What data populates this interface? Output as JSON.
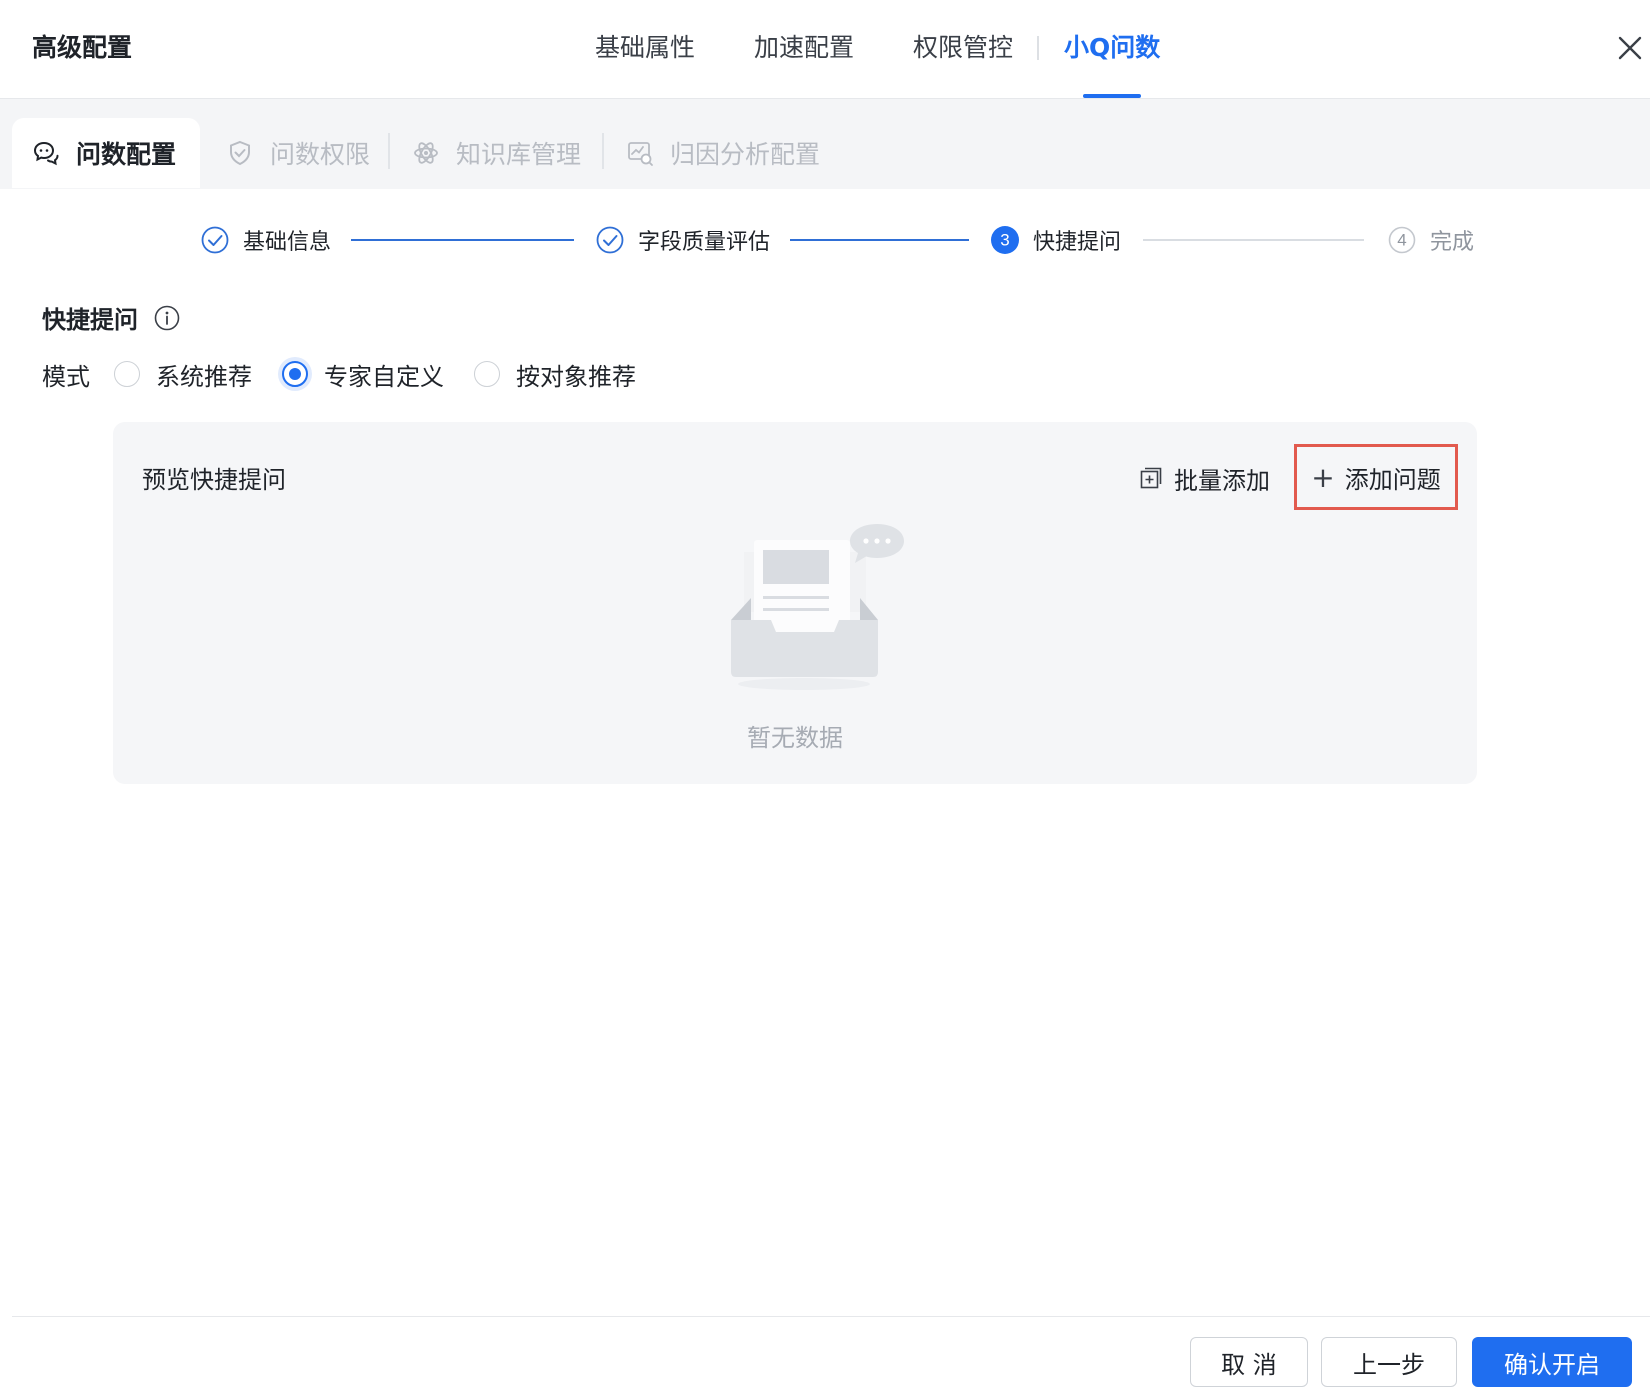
{
  "dialog": {
    "title": "高级配置"
  },
  "top_tabs": [
    {
      "label": "基础属性",
      "active": false
    },
    {
      "label": "加速配置",
      "active": false
    },
    {
      "label": "权限管控",
      "active": false
    },
    {
      "label": "小Q问数",
      "active": true
    }
  ],
  "sub_tabs": [
    {
      "label": "问数配置",
      "icon": "chat-bubbles-icon",
      "active": true
    },
    {
      "label": "问数权限",
      "icon": "shield-check-icon",
      "active": false
    },
    {
      "label": "知识库管理",
      "icon": "atom-icon",
      "active": false
    },
    {
      "label": "归因分析配置",
      "icon": "chart-analysis-icon",
      "active": false
    }
  ],
  "steps": [
    {
      "label": "基础信息",
      "status": "done"
    },
    {
      "label": "字段质量评估",
      "status": "done"
    },
    {
      "label": "快捷提问",
      "status": "current",
      "number": "3"
    },
    {
      "label": "完成",
      "status": "pending",
      "number": "4"
    }
  ],
  "section": {
    "title": "快捷提问",
    "mode_label": "模式",
    "mode_options": [
      {
        "label": "系统推荐",
        "checked": false
      },
      {
        "label": "专家自定义",
        "checked": true
      },
      {
        "label": "按对象推荐",
        "checked": false
      }
    ]
  },
  "preview": {
    "title": "预览快捷提问",
    "batch_add_label": "批量添加",
    "add_question_label": "添加问题",
    "empty_text": "暂无数据"
  },
  "footer": {
    "cancel_label": "取 消",
    "prev_label": "上一步",
    "confirm_label": "确认开启"
  },
  "colors": {
    "accent": "#1f6ef0",
    "highlight_border": "#e25a4e"
  }
}
